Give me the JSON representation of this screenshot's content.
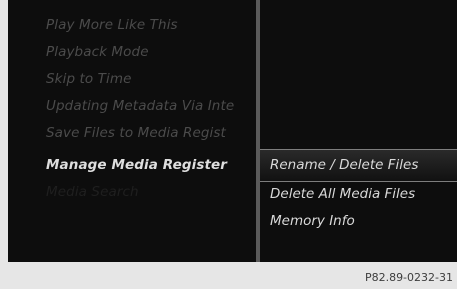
{
  "menu": {
    "items": [
      {
        "label": "Play More Like This",
        "state": "inactive"
      },
      {
        "label": "Playback Mode",
        "state": "inactive"
      },
      {
        "label": "Skip to Time",
        "state": "inactive"
      },
      {
        "label": "Updating Metadata Via Inte",
        "state": "inactive"
      },
      {
        "label": "Save Files to Media Regist",
        "state": "inactive"
      },
      {
        "label": "Manage Media Register",
        "state": "active"
      },
      {
        "label": "Media Search",
        "state": "faint"
      }
    ]
  },
  "submenu": {
    "items": [
      {
        "label": "Rename / Delete Files",
        "selected": true
      },
      {
        "label": "Delete All Media Files",
        "selected": false
      },
      {
        "label": "Memory Info",
        "selected": false
      }
    ]
  },
  "footer": {
    "reference_code": "P82.89-0232-31"
  },
  "colors": {
    "screen_background": "#0d0d0d",
    "inactive_text": "#4b4b4b",
    "active_text": "#dedede",
    "divider": "#5a5a5a",
    "highlight_border": "#7d7d7d"
  }
}
